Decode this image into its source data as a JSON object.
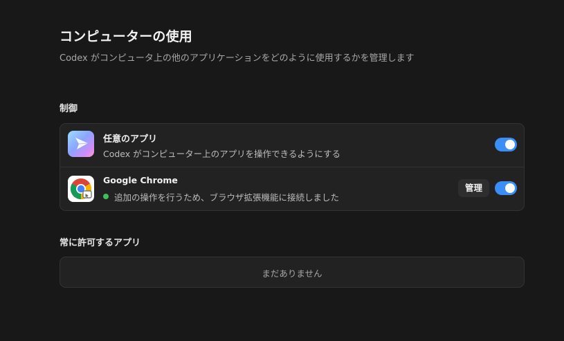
{
  "header": {
    "title": "コンピューターの使用",
    "subtitle": "Codex がコンピュータ上の他のアプリケーションをどのように使用するかを管理します"
  },
  "controls": {
    "heading": "制御",
    "rows": [
      {
        "icon": "codex-app-icon",
        "title": "任意のアプリ",
        "description": "Codex がコンピューター上のアプリを操作できるようにする",
        "enabled": true
      },
      {
        "icon": "chrome-app-icon",
        "title": "Google Chrome",
        "description": "追加の操作を行うため、ブラウザ拡張機能に接続しました",
        "status_color": "#3cc15a",
        "manage_label": "管理",
        "enabled": true
      }
    ]
  },
  "always_allow": {
    "heading": "常に許可するアプリ",
    "empty_text": "まだありません"
  },
  "colors": {
    "accent": "#3a8ef6",
    "background": "#181818",
    "card": "#222222"
  }
}
